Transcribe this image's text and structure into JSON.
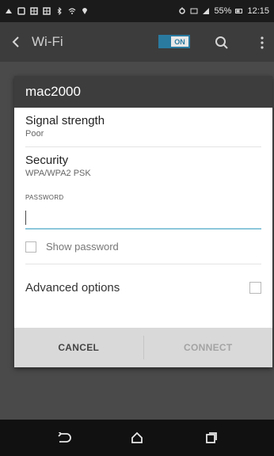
{
  "status_bar": {
    "battery": "55%",
    "time": "12:15"
  },
  "action_bar": {
    "title": "Wi-Fi",
    "toggle_label": "ON"
  },
  "dialog": {
    "title": "mac2000",
    "signal_label": "Signal strength",
    "signal_value": "Poor",
    "security_label": "Security",
    "security_value": "WPA/WPA2 PSK",
    "password_label": "PASSWORD",
    "password_value": "",
    "show_password_label": "Show password",
    "show_password_checked": false,
    "advanced_label": "Advanced options",
    "advanced_checked": false,
    "cancel_label": "CANCEL",
    "connect_label": "CONNECT"
  },
  "colors": {
    "accent": "#2a7aa0",
    "input_underline": "#8cc7dc",
    "dialog_title_bg": "#3d3d3d"
  },
  "icons": [
    "back-arrow-icon",
    "search-icon",
    "more-vert-icon",
    "nav-back-icon",
    "nav-home-icon",
    "nav-recents-icon"
  ]
}
